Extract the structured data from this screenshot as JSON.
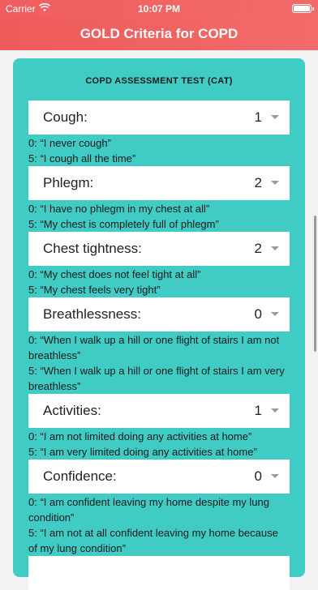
{
  "status": {
    "carrier": "Carrier",
    "time": "10:07 PM"
  },
  "nav": {
    "title": "GOLD Criteria for COPD"
  },
  "card": {
    "title": "COPD ASSESSMENT TEST (CAT)"
  },
  "questions": [
    {
      "label": "Cough:",
      "value": "1",
      "low": "0: “I never cough”",
      "high": "5: “I cough all the time”"
    },
    {
      "label": "Phlegm:",
      "value": "2",
      "low": "0: “I have no phlegm in my chest at all”",
      "high": "5: “My chest is completely full of phlegm”"
    },
    {
      "label": "Chest tightness:",
      "value": "2",
      "low": "0: “My chest does not feel tight at all”",
      "high": "5: “My chest feels very tight”"
    },
    {
      "label": "Breathlessness:",
      "value": "0",
      "low": "0: “When I walk up a hill or one flight of stairs I am not breathless”",
      "high": "5: “When I walk up a hill or one flight of stairs I am very breathless”"
    },
    {
      "label": "Activities:",
      "value": "1",
      "low": "0: “I am not limited doing any activities at home”",
      "high": "5: “I am very limited doing any activities at home”"
    },
    {
      "label": "Confidence:",
      "value": "0",
      "low": "0: “I am confident leaving my home despite my lung condition”",
      "high": "5: “I am not at all confident leaving my home because of my lung condition”"
    }
  ]
}
